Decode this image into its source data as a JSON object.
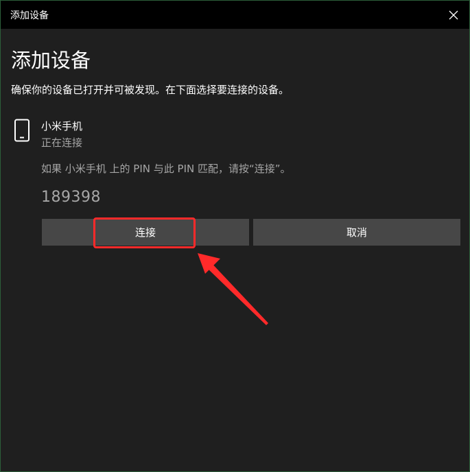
{
  "window": {
    "title": "添加设备",
    "close_symbol": "✕"
  },
  "main": {
    "heading": "添加设备",
    "instructions": "确保你的设备已打开并可被发现。在下面选择要连接的设备。"
  },
  "device": {
    "icon": "phone-icon",
    "name": "小米手机",
    "status": "正在连接",
    "pin_message": "如果 小米手机 上的 PIN 与此 PIN 匹配，请按“连接”。",
    "pin_code": "189398"
  },
  "buttons": {
    "connect_label": "连接",
    "cancel_label": "取消"
  },
  "colors": {
    "background": "#1f1f1f",
    "titlebar": "#000000",
    "button": "#474747",
    "secondary_text": "#a6a6a6",
    "annotation": "#ff2a2a"
  }
}
